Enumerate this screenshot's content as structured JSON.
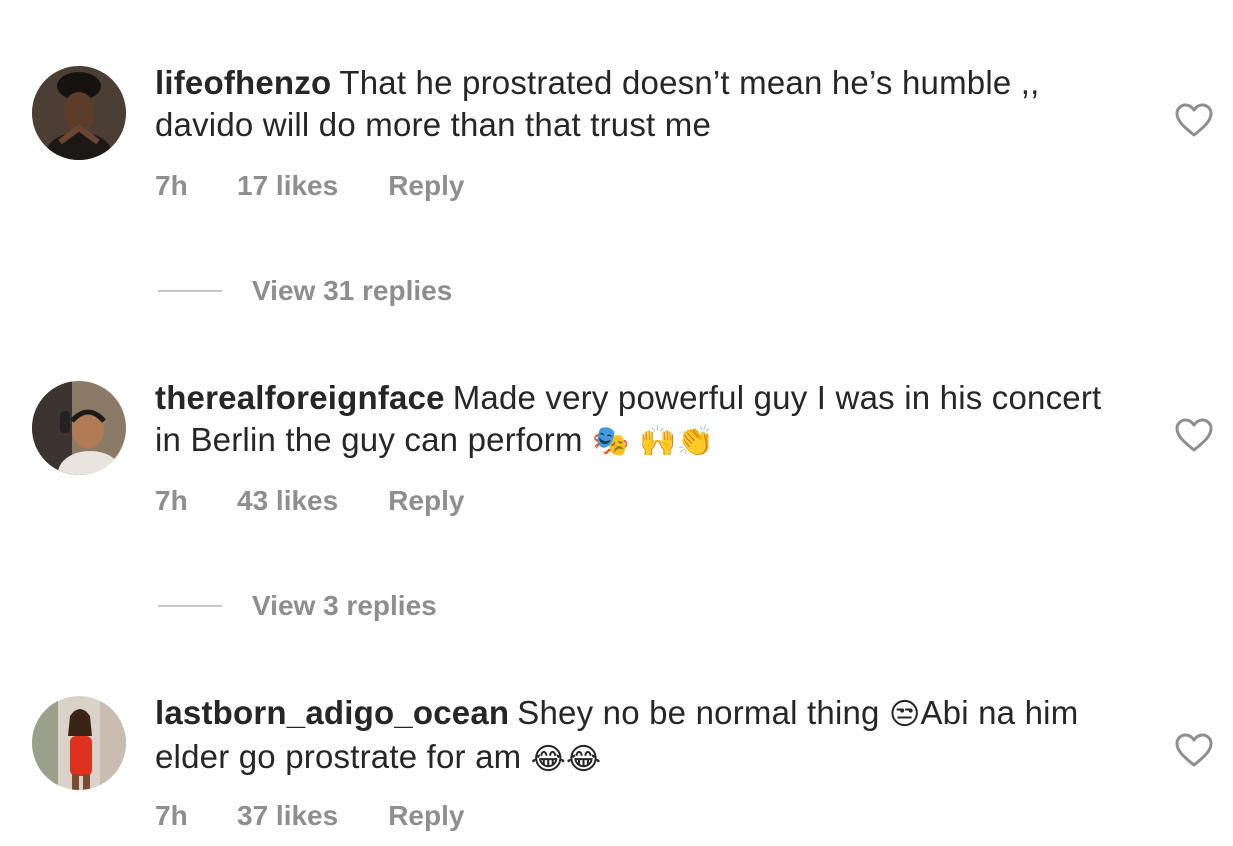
{
  "comments": [
    {
      "username": "lifeofhenzo",
      "text": "That he prostrated doesn’t mean he’s humble ,, davido will do more than that trust me",
      "emojis": "",
      "time": "7h",
      "likes": "17 likes",
      "reply": "Reply",
      "view_replies": "View 31 replies",
      "avatar_icon": "profile-photo"
    },
    {
      "username": "therealforeignface",
      "text": "Made very powerful guy I was in his concert in Berlin the guy can perform",
      "emojis": "🎭 🙌👏",
      "time": "7h",
      "likes": "43 likes",
      "reply": "Reply",
      "view_replies": "View 3 replies",
      "avatar_icon": "profile-photo"
    },
    {
      "username": "lastborn_adigo_ocean",
      "text": "Shey no be normal thing",
      "emoji_mid": "😒",
      "text_after": "Abi na him elder go prostrate for am",
      "emojis": "😂😂",
      "time": "7h",
      "likes": "37 likes",
      "reply": "Reply",
      "avatar_icon": "profile-photo"
    }
  ],
  "icons": {
    "like": "heart-outline-icon"
  },
  "colors": {
    "text": "#262626",
    "secondary": "#8e8e8e",
    "divider": "#c7c7c7"
  }
}
